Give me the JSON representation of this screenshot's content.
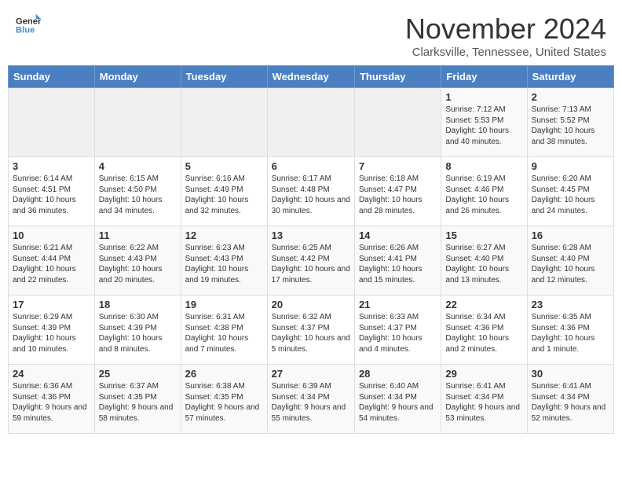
{
  "header": {
    "logo_line1": "General",
    "logo_line2": "Blue",
    "month": "November 2024",
    "location": "Clarksville, Tennessee, United States"
  },
  "weekdays": [
    "Sunday",
    "Monday",
    "Tuesday",
    "Wednesday",
    "Thursday",
    "Friday",
    "Saturday"
  ],
  "weeks": [
    [
      {
        "day": "",
        "info": ""
      },
      {
        "day": "",
        "info": ""
      },
      {
        "day": "",
        "info": ""
      },
      {
        "day": "",
        "info": ""
      },
      {
        "day": "",
        "info": ""
      },
      {
        "day": "1",
        "info": "Sunrise: 7:12 AM\nSunset: 5:53 PM\nDaylight: 10 hours and 40 minutes."
      },
      {
        "day": "2",
        "info": "Sunrise: 7:13 AM\nSunset: 5:52 PM\nDaylight: 10 hours and 38 minutes."
      }
    ],
    [
      {
        "day": "3",
        "info": "Sunrise: 6:14 AM\nSunset: 4:51 PM\nDaylight: 10 hours and 36 minutes."
      },
      {
        "day": "4",
        "info": "Sunrise: 6:15 AM\nSunset: 4:50 PM\nDaylight: 10 hours and 34 minutes."
      },
      {
        "day": "5",
        "info": "Sunrise: 6:16 AM\nSunset: 4:49 PM\nDaylight: 10 hours and 32 minutes."
      },
      {
        "day": "6",
        "info": "Sunrise: 6:17 AM\nSunset: 4:48 PM\nDaylight: 10 hours and 30 minutes."
      },
      {
        "day": "7",
        "info": "Sunrise: 6:18 AM\nSunset: 4:47 PM\nDaylight: 10 hours and 28 minutes."
      },
      {
        "day": "8",
        "info": "Sunrise: 6:19 AM\nSunset: 4:46 PM\nDaylight: 10 hours and 26 minutes."
      },
      {
        "day": "9",
        "info": "Sunrise: 6:20 AM\nSunset: 4:45 PM\nDaylight: 10 hours and 24 minutes."
      }
    ],
    [
      {
        "day": "10",
        "info": "Sunrise: 6:21 AM\nSunset: 4:44 PM\nDaylight: 10 hours and 22 minutes."
      },
      {
        "day": "11",
        "info": "Sunrise: 6:22 AM\nSunset: 4:43 PM\nDaylight: 10 hours and 20 minutes."
      },
      {
        "day": "12",
        "info": "Sunrise: 6:23 AM\nSunset: 4:43 PM\nDaylight: 10 hours and 19 minutes."
      },
      {
        "day": "13",
        "info": "Sunrise: 6:25 AM\nSunset: 4:42 PM\nDaylight: 10 hours and 17 minutes."
      },
      {
        "day": "14",
        "info": "Sunrise: 6:26 AM\nSunset: 4:41 PM\nDaylight: 10 hours and 15 minutes."
      },
      {
        "day": "15",
        "info": "Sunrise: 6:27 AM\nSunset: 4:40 PM\nDaylight: 10 hours and 13 minutes."
      },
      {
        "day": "16",
        "info": "Sunrise: 6:28 AM\nSunset: 4:40 PM\nDaylight: 10 hours and 12 minutes."
      }
    ],
    [
      {
        "day": "17",
        "info": "Sunrise: 6:29 AM\nSunset: 4:39 PM\nDaylight: 10 hours and 10 minutes."
      },
      {
        "day": "18",
        "info": "Sunrise: 6:30 AM\nSunset: 4:39 PM\nDaylight: 10 hours and 8 minutes."
      },
      {
        "day": "19",
        "info": "Sunrise: 6:31 AM\nSunset: 4:38 PM\nDaylight: 10 hours and 7 minutes."
      },
      {
        "day": "20",
        "info": "Sunrise: 6:32 AM\nSunset: 4:37 PM\nDaylight: 10 hours and 5 minutes."
      },
      {
        "day": "21",
        "info": "Sunrise: 6:33 AM\nSunset: 4:37 PM\nDaylight: 10 hours and 4 minutes."
      },
      {
        "day": "22",
        "info": "Sunrise: 6:34 AM\nSunset: 4:36 PM\nDaylight: 10 hours and 2 minutes."
      },
      {
        "day": "23",
        "info": "Sunrise: 6:35 AM\nSunset: 4:36 PM\nDaylight: 10 hours and 1 minute."
      }
    ],
    [
      {
        "day": "24",
        "info": "Sunrise: 6:36 AM\nSunset: 4:36 PM\nDaylight: 9 hours and 59 minutes."
      },
      {
        "day": "25",
        "info": "Sunrise: 6:37 AM\nSunset: 4:35 PM\nDaylight: 9 hours and 58 minutes."
      },
      {
        "day": "26",
        "info": "Sunrise: 6:38 AM\nSunset: 4:35 PM\nDaylight: 9 hours and 57 minutes."
      },
      {
        "day": "27",
        "info": "Sunrise: 6:39 AM\nSunset: 4:34 PM\nDaylight: 9 hours and 55 minutes."
      },
      {
        "day": "28",
        "info": "Sunrise: 6:40 AM\nSunset: 4:34 PM\nDaylight: 9 hours and 54 minutes."
      },
      {
        "day": "29",
        "info": "Sunrise: 6:41 AM\nSunset: 4:34 PM\nDaylight: 9 hours and 53 minutes."
      },
      {
        "day": "30",
        "info": "Sunrise: 6:41 AM\nSunset: 4:34 PM\nDaylight: 9 hours and 52 minutes."
      }
    ]
  ]
}
